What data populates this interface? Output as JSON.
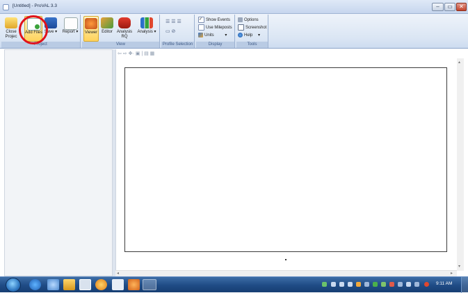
{
  "window": {
    "title": "[Untitled] - ProVAL 3.3"
  },
  "ribbon": {
    "groups": [
      {
        "label": "Project",
        "buttons": [
          "Close Project",
          "Add Files",
          "Save",
          "Report"
        ]
      },
      {
        "label": "View",
        "buttons": [
          "Viewer",
          "Editor",
          "Analysis RQ",
          "Analysis"
        ]
      },
      {
        "label": "Profile Selection"
      },
      {
        "label": "Display",
        "items": [
          "Show Events",
          "Use Mileposts",
          "Units"
        ]
      },
      {
        "label": "Tools",
        "items": [
          "Options",
          "Screenshot",
          "Help"
        ]
      }
    ],
    "close_label": "Close",
    "project_label_partial": "Projec",
    "add_files_label": "Add Files",
    "save_label": "Save",
    "report_label": "Report",
    "viewer_label": "Viewer",
    "editor_label": "Editor",
    "analysis_rq_label": "Analysis\nRQ",
    "analysis_label": "Analysis",
    "display_items": {
      "show_events": "Show Events",
      "use_mileposts": "Use Mileposts",
      "units": "Units"
    },
    "tools_items": {
      "options": "Options",
      "screenshot": "Screenshot",
      "help": "Help"
    },
    "group_labels": {
      "project": "Project",
      "view": "View",
      "profile_selection": "Profile Selection",
      "display": "Display",
      "tools": "Tools"
    }
  },
  "viewer_toolbar": "⇦ ⇨ ✥· ▣ | ▤ ▦",
  "taskbar": {
    "clock": "9:11 AM"
  },
  "colors": {
    "highlight": "#e0121b",
    "ribbon": "#dbe6f4",
    "taskbar": "#1f4b85"
  }
}
